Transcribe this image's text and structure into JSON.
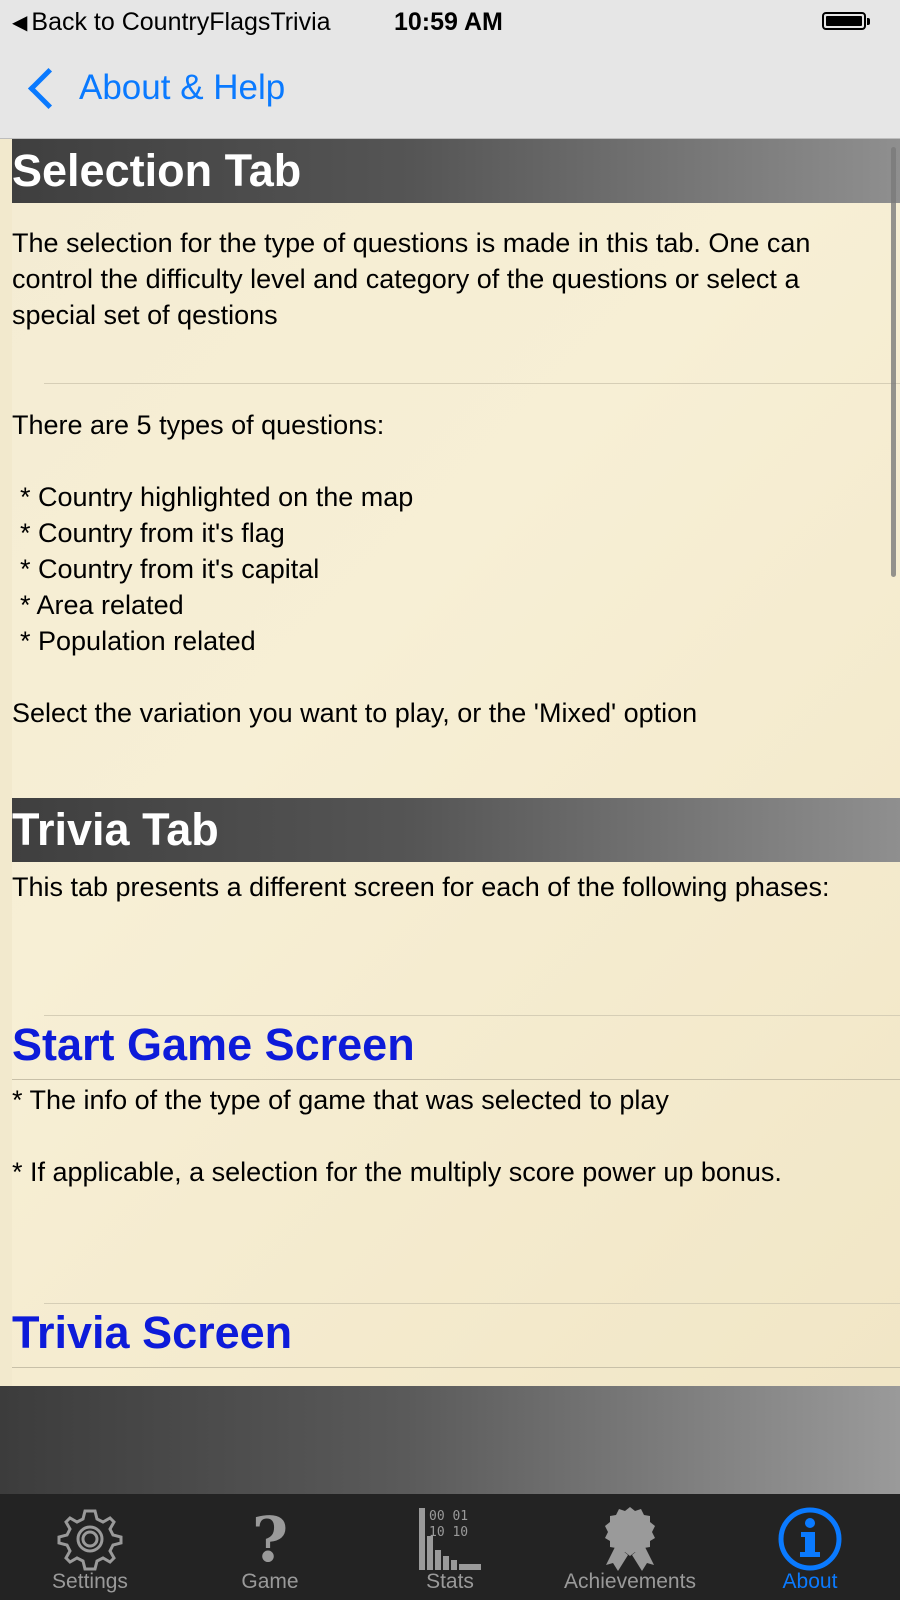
{
  "status_bar": {
    "back_app_label": "Back to CountryFlagsTrivia",
    "time": "10:59 AM"
  },
  "nav": {
    "back_label": "About & Help"
  },
  "content": {
    "selection_tab": {
      "heading": "Selection Tab",
      "intro": "The selection for the type of questions is made in this tab. One can control the difficulty level and category of the questions or select a special set of qestions",
      "types_intro": "There are 5 types of questions:",
      "types": [
        "* Country highlighted on the map",
        "* Country from it's flag",
        "* Country from it's capital",
        "* Area related",
        "* Population related"
      ],
      "outro": "Select the variation you want to play, or the 'Mixed' option"
    },
    "trivia_tab": {
      "heading": "Trivia Tab",
      "intro": "This tab presents a different screen for each of the following phases:"
    },
    "start_game_screen": {
      "heading": "Start Game Screen",
      "item1": " * The info of the type of game that was selected to play",
      "item2": " * If applicable, a selection for the multiply score power up bonus."
    },
    "trivia_screen": {
      "heading": "Trivia Screen"
    }
  },
  "tabs": [
    {
      "label": "Settings",
      "icon": "gear-icon"
    },
    {
      "label": "Game",
      "icon": "question-icon"
    },
    {
      "label": "Stats",
      "icon": "stats-icon"
    },
    {
      "label": "Achievements",
      "icon": "ribbon-icon"
    },
    {
      "label": "About",
      "icon": "info-icon"
    }
  ],
  "colors": {
    "accent": "#0a7aff",
    "heading_blue": "#0d1bd9",
    "content_bg": "#f4ecd3",
    "tab_bar_bg": "#232323"
  }
}
